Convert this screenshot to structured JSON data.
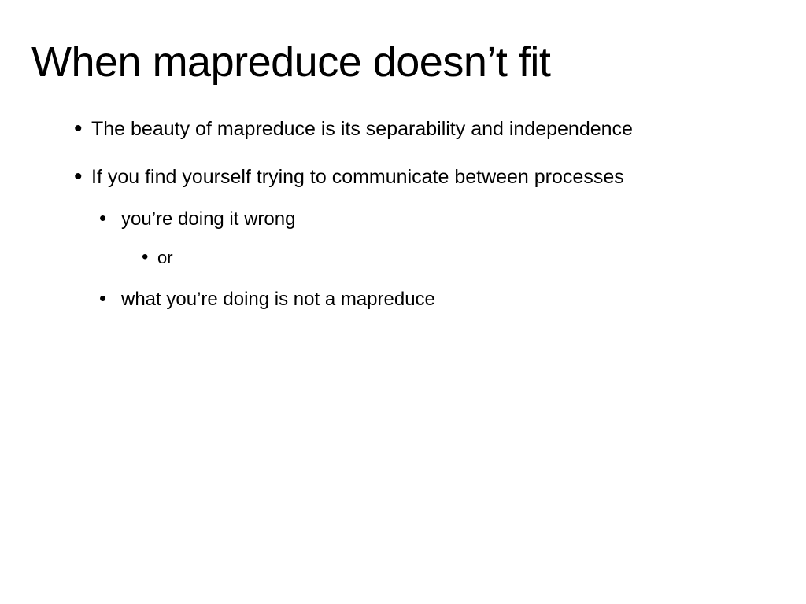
{
  "title": "When mapreduce doesn’t fit",
  "bullets": {
    "item1": "The beauty of mapreduce is its separability and independence",
    "item2": "If you find yourself trying to communicate between processes",
    "sub1": "you’re doing it wrong",
    "subsub1": "or",
    "sub2": "what you’re doing is not a mapreduce"
  }
}
